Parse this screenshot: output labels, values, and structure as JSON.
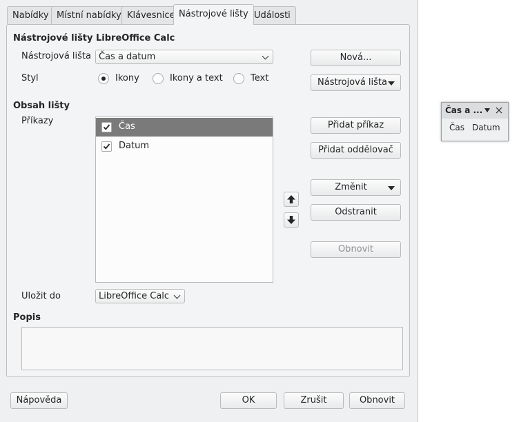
{
  "tabs": [
    {
      "label": "Nabídky",
      "active": false
    },
    {
      "label": "Místní nabídky",
      "active": false
    },
    {
      "label": "Klávesnice",
      "active": false
    },
    {
      "label": "Nástrojové lišty",
      "active": true
    },
    {
      "label": "Události",
      "active": false
    }
  ],
  "section_title": "Nástrojové lišty LibreOffice Calc",
  "toolbar_field": {
    "label": "Nástrojová lišta",
    "value": "Čas a datum"
  },
  "style_field": {
    "label": "Styl",
    "options": [
      {
        "label": "Ikony",
        "selected": true
      },
      {
        "label": "Ikony a text",
        "selected": false
      },
      {
        "label": "Text",
        "selected": false
      }
    ]
  },
  "right_buttons": {
    "new": "Nová...",
    "toolbar_menu": "Nástrojová lišta"
  },
  "contents": {
    "title": "Obsah lišty",
    "commands_label": "Příkazy",
    "items": [
      {
        "label": "Čas",
        "checked": true,
        "selected": true
      },
      {
        "label": "Datum",
        "checked": true,
        "selected": false
      }
    ]
  },
  "command_buttons": {
    "add_command": "Přidat příkaz",
    "add_separator": "Přidat oddělovač",
    "modify": "Změnit",
    "delete": "Odstranit",
    "reset": "Obnovit"
  },
  "save_in": {
    "label": "Uložit do",
    "value": "LibreOffice Calc"
  },
  "description": {
    "label": "Popis",
    "text": ""
  },
  "footer": {
    "help": "Nápověda",
    "ok": "OK",
    "cancel": "Zrušit",
    "reset": "Obnovit"
  },
  "floating_toolbar": {
    "title": "Čas a ...",
    "items": [
      "Čas",
      "Datum"
    ]
  },
  "colors": {
    "selection": "#7a7a7a",
    "window_bg": "#eff0f1"
  }
}
